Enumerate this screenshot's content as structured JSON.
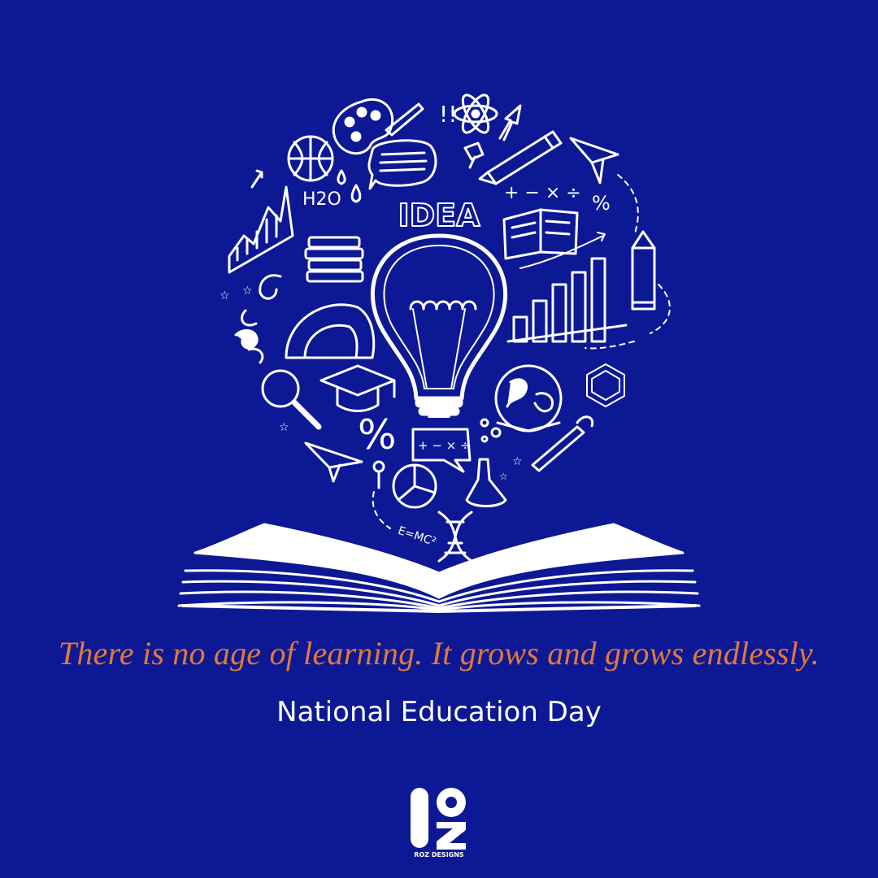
{
  "illustration": {
    "idea_word": "IDEA",
    "formula_water": "H2O",
    "formula_energy": "E=MC²",
    "math_symbols": "+ − × ÷",
    "percent_symbol": "%",
    "exclamation": "!!"
  },
  "quote": "There is no age of learning. It grows and grows endlessly.",
  "title": "National Education Day",
  "brand": {
    "logo_mark": "RZ",
    "caption": "ROZ DESIGNS"
  },
  "colors": {
    "background": "#0d1894",
    "line_art": "#ffffff",
    "quote": "#e0793a",
    "title": "#ffffff"
  }
}
